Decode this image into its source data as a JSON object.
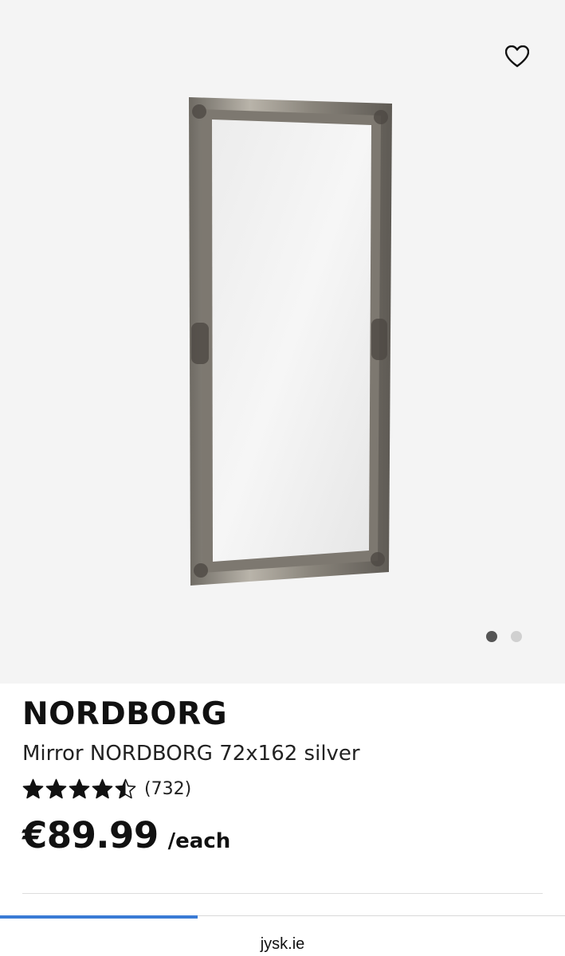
{
  "product": {
    "brand": "NORDBORG",
    "name": "Mirror NORDBORG 72x162 silver",
    "rating": 4.5,
    "rating_max": 5,
    "review_count": "(732)",
    "price": "€89.99",
    "unit": "/each",
    "image_icon": "mirror-image"
  },
  "gallery": {
    "favorite_icon": "heart-outline-icon",
    "image_count": 2,
    "active_index": 0,
    "dot_active_color": "#555555",
    "dot_inactive_color": "#d0d0d0",
    "background": "#f4f4f4"
  },
  "browser": {
    "url": "jysk.ie",
    "load_progress": 0.35,
    "progress_color": "#3a7bd5"
  }
}
